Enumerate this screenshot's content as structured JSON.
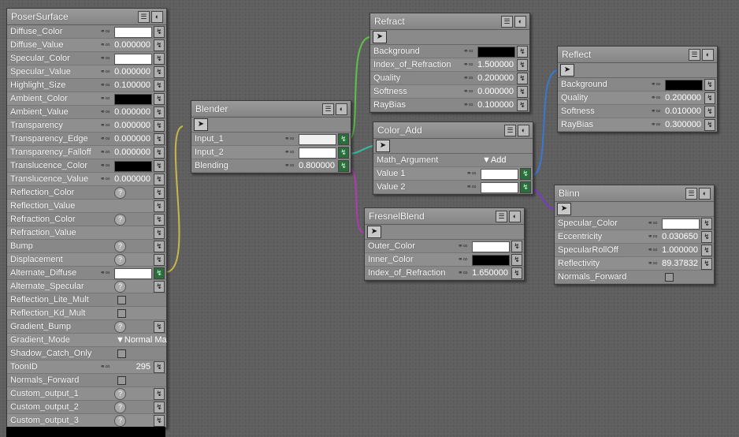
{
  "colors": {
    "wire_yellow": "#c8b84a",
    "wire_green": "#5cc24a",
    "wire_teal": "#3ab89a",
    "wire_magenta": "#b03ab0",
    "wire_blue": "#3a78d0",
    "wire_purple": "#7a3ac8",
    "white": "#ffffff",
    "black": "#000000"
  },
  "poser": {
    "title": "PoserSurface",
    "rows": [
      {
        "label": "Diffuse_Color",
        "type": "color",
        "color": "#ffffff"
      },
      {
        "label": "Diffuse_Value",
        "type": "value",
        "value": "0.000000"
      },
      {
        "label": "Specular_Color",
        "type": "color",
        "color": "#ffffff"
      },
      {
        "label": "Specular_Value",
        "type": "value",
        "value": "0.000000"
      },
      {
        "label": "Highlight_Size",
        "type": "value",
        "value": "0.100000"
      },
      {
        "label": "Ambient_Color",
        "type": "color",
        "color": "#000000"
      },
      {
        "label": "Ambient_Value",
        "type": "value",
        "value": "0.000000"
      },
      {
        "label": "Transparency",
        "type": "value",
        "value": "0.000000"
      },
      {
        "label": "Transparency_Edge",
        "type": "value",
        "value": "0.000000"
      },
      {
        "label": "Transparency_Falloff",
        "type": "value",
        "value": "0.000000"
      },
      {
        "label": "Translucence_Color",
        "type": "color",
        "color": "#000000"
      },
      {
        "label": "Translucence_Value",
        "type": "value",
        "value": "0.000000"
      },
      {
        "label": "Reflection_Color",
        "type": "help"
      },
      {
        "label": "Reflection_Value",
        "type": "plug"
      },
      {
        "label": "Refraction_Color",
        "type": "help"
      },
      {
        "label": "Refraction_Value",
        "type": "plug"
      },
      {
        "label": "Bump",
        "type": "help"
      },
      {
        "label": "Displacement",
        "type": "help"
      },
      {
        "label": "Alternate_Diffuse",
        "type": "color-connected",
        "color": "#ffffff"
      },
      {
        "label": "Alternate_Specular",
        "type": "help"
      },
      {
        "label": "Reflection_Lite_Mult",
        "type": "check"
      },
      {
        "label": "Reflection_Kd_Mult",
        "type": "check"
      },
      {
        "label": "Gradient_Bump",
        "type": "help"
      },
      {
        "label": "Gradient_Mode",
        "type": "dropdown",
        "value": "Normal Ma"
      },
      {
        "label": "Shadow_Catch_Only",
        "type": "check"
      },
      {
        "label": "ToonID",
        "type": "value",
        "value": "295"
      },
      {
        "label": "Normals_Forward",
        "type": "check"
      },
      {
        "label": "Custom_output_1",
        "type": "help"
      },
      {
        "label": "Custom_output_2",
        "type": "help"
      },
      {
        "label": "Custom_output_3",
        "type": "help"
      }
    ]
  },
  "blender": {
    "title": "Blender",
    "rows": [
      {
        "label": "Input_1",
        "type": "color-connected",
        "color": "#f0f0f0"
      },
      {
        "label": "Input_2",
        "type": "color-connected",
        "color": "#ffffff"
      },
      {
        "label": "Blending",
        "type": "value-connected",
        "value": "0.800000"
      }
    ]
  },
  "refract": {
    "title": "Refract",
    "rows": [
      {
        "label": "Background",
        "type": "color",
        "color": "#000000"
      },
      {
        "label": "Index_of_Refraction",
        "type": "value",
        "value": "1.500000"
      },
      {
        "label": "Quality",
        "type": "value",
        "value": "0.200000"
      },
      {
        "label": "Softness",
        "type": "value",
        "value": "0.000000"
      },
      {
        "label": "RayBias",
        "type": "value",
        "value": "0.100000"
      }
    ]
  },
  "color_add": {
    "title": "Color_Add",
    "rows": [
      {
        "label": "Math_Argument",
        "type": "dropdown",
        "value": "Add"
      },
      {
        "label": "Value 1",
        "type": "color-connected",
        "color": "#ffffff"
      },
      {
        "label": "Value 2",
        "type": "color-connected",
        "color": "#ffffff"
      }
    ]
  },
  "fresnel": {
    "title": "FresnelBlend",
    "rows": [
      {
        "label": "Outer_Color",
        "type": "color",
        "color": "#ffffff"
      },
      {
        "label": "Inner_Color",
        "type": "color",
        "color": "#000000"
      },
      {
        "label": "Index_of_Refraction",
        "type": "value",
        "value": "1.650000"
      }
    ]
  },
  "reflect": {
    "title": "Reflect",
    "rows": [
      {
        "label": "Background",
        "type": "color",
        "color": "#000000"
      },
      {
        "label": "Quality",
        "type": "value",
        "value": "0.200000"
      },
      {
        "label": "Softness",
        "type": "value",
        "value": "0.010000"
      },
      {
        "label": "RayBias",
        "type": "value",
        "value": "0.300000"
      }
    ]
  },
  "blinn": {
    "title": "Blinn",
    "rows": [
      {
        "label": "Specular_Color",
        "type": "color",
        "color": "#ffffff"
      },
      {
        "label": "Eccentricity",
        "type": "value",
        "value": "0.030650"
      },
      {
        "label": "SpecularRollOff",
        "type": "value",
        "value": "1.000000"
      },
      {
        "label": "Reflectivity",
        "type": "value",
        "value": "89.37832"
      },
      {
        "label": "Normals_Forward",
        "type": "check"
      }
    ]
  },
  "icons": {
    "list": "list-icon",
    "eye": "eye-icon",
    "plug": "plug-icon",
    "help": "help-icon",
    "link": "link-icon",
    "node": "node-options-icon"
  }
}
